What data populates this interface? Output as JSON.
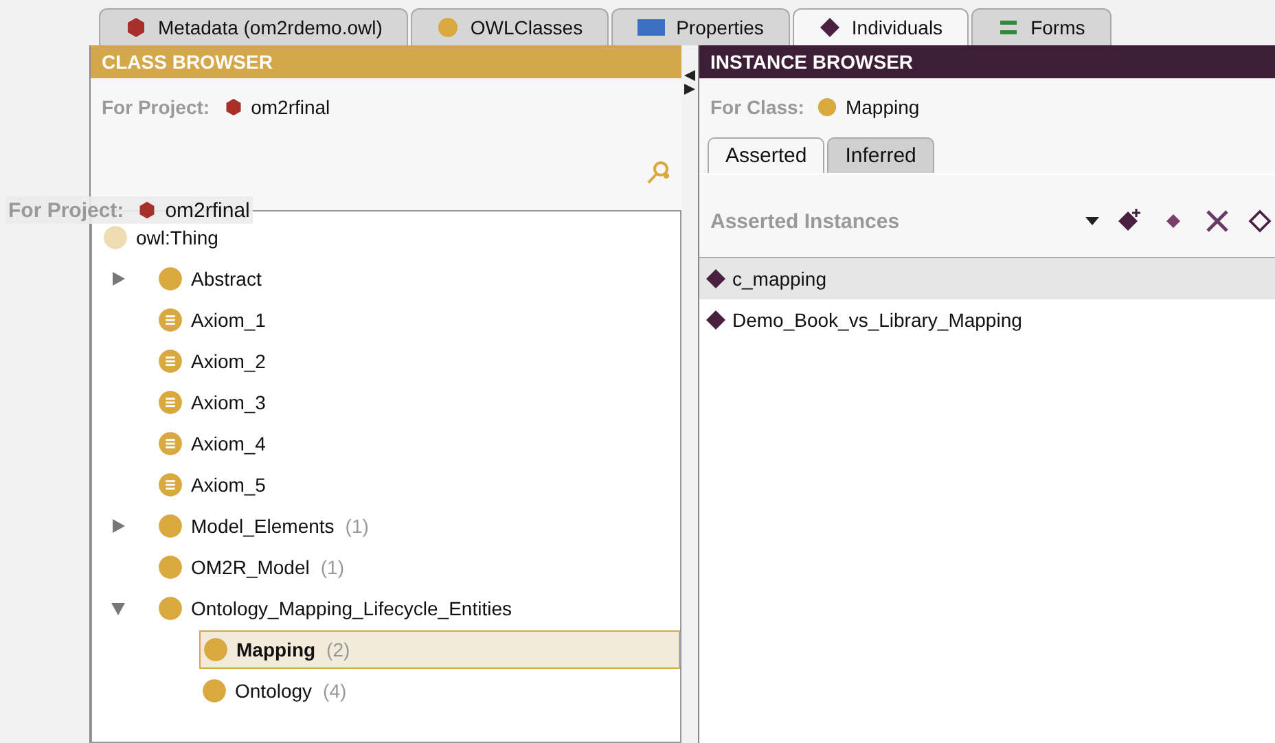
{
  "tabs": [
    {
      "label": "Metadata (om2rdemo.owl)",
      "kind": "metadata",
      "selected": false
    },
    {
      "label": "OWLClasses",
      "kind": "classes",
      "selected": false
    },
    {
      "label": "Properties",
      "kind": "properties",
      "selected": false
    },
    {
      "label": "Individuals",
      "kind": "individuals",
      "selected": true
    },
    {
      "label": "Forms",
      "kind": "forms",
      "selected": false
    }
  ],
  "class_browser": {
    "title": "CLASS BROWSER",
    "project_label": "For Project:",
    "project": "om2rfinal",
    "tree": [
      {
        "label": "owl:Thing",
        "kind": "root",
        "selected": false,
        "children": [
          {
            "label": "Abstract",
            "kind": "class",
            "expanded": false,
            "selected": false
          },
          {
            "label": "Axiom_1",
            "kind": "axiom",
            "selected": false
          },
          {
            "label": "Axiom_2",
            "kind": "axiom",
            "selected": false
          },
          {
            "label": "Axiom_3",
            "kind": "axiom",
            "selected": false
          },
          {
            "label": "Axiom_4",
            "kind": "axiom",
            "selected": false
          },
          {
            "label": "Axiom_5",
            "kind": "axiom",
            "selected": false
          },
          {
            "label": "Model_Elements",
            "count": "(1)",
            "kind": "class",
            "expanded": false,
            "selected": false
          },
          {
            "label": "OM2R_Model",
            "count": "(1)",
            "kind": "class",
            "selected": false
          },
          {
            "label": "Ontology_Mapping_Lifecycle_Entities",
            "kind": "class",
            "expanded": true,
            "selected": false,
            "children": [
              {
                "label": "Mapping",
                "count": "(2)",
                "kind": "class",
                "selected": true
              },
              {
                "label": "Ontology",
                "count": "(4)",
                "kind": "class",
                "selected": false
              }
            ]
          }
        ]
      }
    ]
  },
  "drag_ghost": {
    "label": "For Project:",
    "value": "om2rfinal"
  },
  "instance_browser": {
    "title": "INSTANCE BROWSER",
    "class_label": "For Class:",
    "class": "Mapping",
    "subtabs": [
      {
        "label": "Asserted",
        "selected": true
      },
      {
        "label": "Inferred",
        "selected": false
      }
    ],
    "list_title": "Asserted Instances",
    "instances": [
      {
        "label": "c_mapping",
        "selected": true
      },
      {
        "label": "Demo_Book_vs_Library_Mapping",
        "selected": false
      }
    ]
  }
}
